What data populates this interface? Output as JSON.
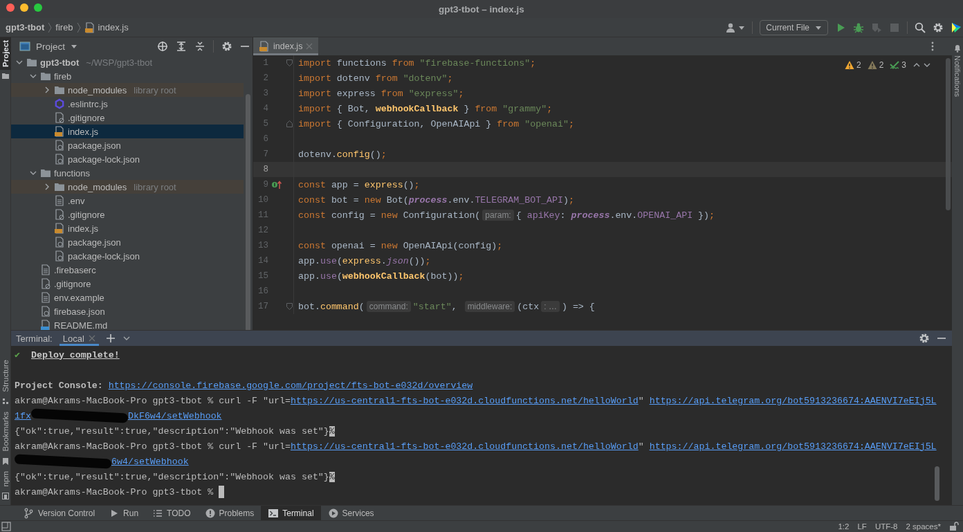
{
  "window": {
    "title": "gpt3-tbot – index.js"
  },
  "breadcrumbs": [
    {
      "label": "gpt3-tbot",
      "kind": "project"
    },
    {
      "label": "fireb",
      "kind": "folder"
    },
    {
      "label": "index.js",
      "kind": "js"
    }
  ],
  "toolbar": {
    "configuration": "Current File",
    "actions": [
      {
        "kind": "run",
        "disabled": false
      },
      {
        "kind": "debug",
        "disabled": false
      },
      {
        "kind": "coverage",
        "disabled": true
      },
      {
        "kind": "stop",
        "disabled": true
      }
    ]
  },
  "left_stripe": {
    "top": [
      {
        "label": "Project",
        "selected": true
      }
    ],
    "bottom": [
      {
        "label": "Structure",
        "selected": false
      },
      {
        "label": "Bookmarks",
        "selected": false
      },
      {
        "label": "npm",
        "selected": false
      }
    ]
  },
  "right_stripe": {
    "label": "Notifications"
  },
  "project_panel": {
    "title": "Project",
    "tree": [
      {
        "label": "gpt3-tbot",
        "path": "~/WSP/gpt3-tbot",
        "kind": "folder",
        "expanded": true,
        "selected": false,
        "children": [
          {
            "label": "fireb",
            "kind": "folder",
            "expanded": true,
            "selected": false,
            "children": [
              {
                "label": "node_modules",
                "note": "library root",
                "kind": "folder",
                "expanded": false,
                "selected": false
              },
              {
                "label": ".eslintrc.js",
                "kind": "eslint",
                "selected": false
              },
              {
                "label": ".gitignore",
                "kind": "ignore",
                "selected": false
              },
              {
                "label": "index.js",
                "kind": "js",
                "selected": true
              },
              {
                "label": "package.json",
                "kind": "json",
                "selected": false
              },
              {
                "label": "package-lock.json",
                "kind": "json",
                "selected": false
              }
            ]
          },
          {
            "label": "functions",
            "kind": "folder",
            "expanded": true,
            "selected": false,
            "children": [
              {
                "label": "node_modules",
                "note": "library root",
                "kind": "folder",
                "expanded": false,
                "selected": false
              },
              {
                "label": ".env",
                "kind": "text",
                "selected": false
              },
              {
                "label": ".gitignore",
                "kind": "ignore",
                "selected": false
              },
              {
                "label": "index.js",
                "kind": "js",
                "selected": false
              },
              {
                "label": "package.json",
                "kind": "json",
                "selected": false
              },
              {
                "label": "package-lock.json",
                "kind": "json",
                "selected": false
              }
            ]
          },
          {
            "label": ".firebaserc",
            "kind": "text",
            "selected": false
          },
          {
            "label": ".gitignore",
            "kind": "ignore",
            "selected": false
          },
          {
            "label": "env.example",
            "kind": "text",
            "selected": false
          },
          {
            "label": "firebase.json",
            "kind": "json",
            "selected": false
          },
          {
            "label": "README.md",
            "kind": "md",
            "selected": false
          }
        ]
      }
    ]
  },
  "editor": {
    "tabs": [
      {
        "label": "index.js",
        "selected": true
      }
    ],
    "inspections": [
      {
        "kind": "warning",
        "count": "2"
      },
      {
        "kind": "weak",
        "count": "2"
      },
      {
        "kind": "typo",
        "count": "3"
      }
    ],
    "lines": [
      {
        "number": "1",
        "kind": "foldstart",
        "current": false,
        "tokens": [
          {
            "kind": "kw",
            "text": "import"
          },
          {
            "kind": "plain",
            "text": " functions "
          },
          {
            "kind": "kw",
            "text": "from "
          },
          {
            "kind": "str",
            "text": "\"firebase-functions\""
          },
          {
            "kind": "kw",
            "text": ";"
          }
        ]
      },
      {
        "number": "2",
        "kind": "plain",
        "current": false,
        "tokens": [
          {
            "kind": "kw",
            "text": "import"
          },
          {
            "kind": "plain",
            "text": " dotenv "
          },
          {
            "kind": "kw",
            "text": "from "
          },
          {
            "kind": "str",
            "text": "\"dotenv\""
          },
          {
            "kind": "kw",
            "text": ";"
          }
        ]
      },
      {
        "number": "3",
        "kind": "plain",
        "current": false,
        "tokens": [
          {
            "kind": "kw",
            "text": "import"
          },
          {
            "kind": "plain",
            "text": " express "
          },
          {
            "kind": "kw",
            "text": "from "
          },
          {
            "kind": "str",
            "text": "\"express\""
          },
          {
            "kind": "kw",
            "text": ";"
          }
        ]
      },
      {
        "number": "4",
        "kind": "plain",
        "current": false,
        "tokens": [
          {
            "kind": "kw",
            "text": "import"
          },
          {
            "kind": "plain",
            "text": " { Bot, "
          },
          {
            "kind": "fnb",
            "text": "webhookCallback"
          },
          {
            "kind": "plain",
            "text": " } "
          },
          {
            "kind": "kw",
            "text": "from "
          },
          {
            "kind": "str",
            "text": "\"grammy\""
          },
          {
            "kind": "kw",
            "text": ";"
          }
        ]
      },
      {
        "number": "5",
        "kind": "foldend",
        "current": false,
        "tokens": [
          {
            "kind": "kw",
            "text": "import"
          },
          {
            "kind": "plain",
            "text": " { Configuration, OpenAIApi } "
          },
          {
            "kind": "kw",
            "text": "from "
          },
          {
            "kind": "str",
            "text": "\"openai\""
          },
          {
            "kind": "kw",
            "text": ";"
          }
        ]
      },
      {
        "number": "6",
        "kind": "plain",
        "current": false
      },
      {
        "number": "7",
        "kind": "plain",
        "current": false,
        "tokens": [
          {
            "kind": "plain",
            "text": "dotenv."
          },
          {
            "kind": "fn",
            "text": "config"
          },
          {
            "kind": "plain",
            "text": "()"
          },
          {
            "kind": "kw",
            "text": ";"
          }
        ]
      },
      {
        "number": "8",
        "kind": "plain",
        "current": true
      },
      {
        "number": "9",
        "kind": "override",
        "current": false,
        "tokens": [
          {
            "kind": "kw",
            "text": "const"
          },
          {
            "kind": "plain",
            "text": " app = "
          },
          {
            "kind": "fn",
            "text": "express"
          },
          {
            "kind": "plain",
            "text": "()"
          },
          {
            "kind": "kw",
            "text": ";"
          }
        ]
      },
      {
        "number": "10",
        "kind": "plain",
        "current": false,
        "tokens": [
          {
            "kind": "kw",
            "text": "const"
          },
          {
            "kind": "plain",
            "text": " bot = "
          },
          {
            "kind": "kw",
            "text": "new"
          },
          {
            "kind": "plain",
            "text": " Bot("
          },
          {
            "kind": "global",
            "text": "process"
          },
          {
            "kind": "plain",
            "text": ".env."
          },
          {
            "kind": "prop",
            "text": "TELEGRAM_BOT_API"
          },
          {
            "kind": "plain",
            "text": ")"
          },
          {
            "kind": "kw",
            "text": ";"
          }
        ]
      },
      {
        "number": "11",
        "kind": "plain",
        "current": false,
        "tokens": [
          {
            "kind": "kw",
            "text": "const"
          },
          {
            "kind": "plain",
            "text": " config = "
          },
          {
            "kind": "kw",
            "text": "new"
          },
          {
            "kind": "plain",
            "text": " Configuration("
          },
          {
            "kind": "hint",
            "text": "param:"
          },
          {
            "kind": "plain",
            "text": "{ "
          },
          {
            "kind": "prop",
            "text": "apiKey"
          },
          {
            "kind": "plain",
            "text": ": "
          },
          {
            "kind": "global",
            "text": "process"
          },
          {
            "kind": "plain",
            "text": ".env."
          },
          {
            "kind": "prop",
            "text": "OPENAI_API"
          },
          {
            "kind": "plain",
            "text": " })"
          },
          {
            "kind": "kw",
            "text": ";"
          }
        ]
      },
      {
        "number": "12",
        "kind": "plain",
        "current": false
      },
      {
        "number": "13",
        "kind": "plain",
        "current": false,
        "tokens": [
          {
            "kind": "kw",
            "text": "const"
          },
          {
            "kind": "plain",
            "text": " openai = "
          },
          {
            "kind": "kw",
            "text": "new"
          },
          {
            "kind": "plain",
            "text": " OpenAIApi(config)"
          },
          {
            "kind": "kw",
            "text": ";"
          }
        ]
      },
      {
        "number": "14",
        "kind": "plain",
        "current": false,
        "tokens": [
          {
            "kind": "plain",
            "text": "app."
          },
          {
            "kind": "prop",
            "text": "use"
          },
          {
            "kind": "plain",
            "text": "("
          },
          {
            "kind": "fn",
            "text": "express"
          },
          {
            "kind": "plain",
            "text": "."
          },
          {
            "kind": "method",
            "text": "json"
          },
          {
            "kind": "plain",
            "text": "())"
          },
          {
            "kind": "kw",
            "text": ";"
          }
        ]
      },
      {
        "number": "15",
        "kind": "plain",
        "current": false,
        "tokens": [
          {
            "kind": "plain",
            "text": "app."
          },
          {
            "kind": "prop",
            "text": "use"
          },
          {
            "kind": "plain",
            "text": "("
          },
          {
            "kind": "fnb",
            "text": "webhookCallback"
          },
          {
            "kind": "plain",
            "text": "(bot))"
          },
          {
            "kind": "kw",
            "text": ";"
          }
        ]
      },
      {
        "number": "16",
        "kind": "plain",
        "current": false
      },
      {
        "number": "17",
        "kind": "foldstart",
        "current": false,
        "tokens": [
          {
            "kind": "plain",
            "text": "bot."
          },
          {
            "kind": "fn",
            "text": "command"
          },
          {
            "kind": "plain",
            "text": "("
          },
          {
            "kind": "hint",
            "text": "command:"
          },
          {
            "kind": "str",
            "text": "\"start\""
          },
          {
            "kind": "plain",
            "text": ", "
          },
          {
            "kind": "hint",
            "text": "middleware:"
          },
          {
            "kind": "plain",
            "text": "(ctx"
          },
          {
            "kind": "hint",
            "text": ": …"
          },
          {
            "kind": "plain",
            "text": ") => {"
          }
        ]
      }
    ]
  },
  "terminal": {
    "label": "Terminal:",
    "tabs": [
      {
        "label": "Local",
        "selected": true
      }
    ],
    "lines": [
      {
        "segments": [
          {
            "kind": "check",
            "text": "✔"
          },
          {
            "kind": "heading",
            "text": "Deploy complete!"
          }
        ]
      },
      {
        "gap_before": true,
        "segments": [
          {
            "kind": "bold",
            "text": "Project Console: "
          },
          {
            "kind": "link",
            "text": "https://console.firebase.google.com/project/fts-bot-e032d/overview"
          }
        ]
      },
      {
        "segments": [
          {
            "kind": "text",
            "text": "akram@Akrams-MacBook-Pro gpt3-tbot % curl -F \"url="
          },
          {
            "kind": "link",
            "text": "https://us-central1-fts-bot-e032d.cloudfunctions.net/helloWorld"
          },
          {
            "kind": "text",
            "text": "\" "
          },
          {
            "kind": "link",
            "text": "https://api.telegram.org/bot5913236674:AAENVI7eEIj5L"
          }
        ]
      },
      {
        "segments": [
          {
            "kind": "link",
            "text": "1fx"
          },
          {
            "kind": "redacted"
          },
          {
            "kind": "link",
            "text": "DkF6w4/setWebhook"
          }
        ]
      },
      {
        "segments": [
          {
            "kind": "text",
            "text": "{\"ok\":true,\"result\":true,\"description\":\"Webhook was set\"}"
          },
          {
            "kind": "inverse",
            "text": "%"
          }
        ]
      },
      {
        "segments": [
          {
            "kind": "text",
            "text": "akram@Akrams-MacBook-Pro gpt3-tbot % curl -F \"url="
          },
          {
            "kind": "link",
            "text": "https://us-central1-fts-bot-e032d.cloudfunctions.net/helloWorld"
          },
          {
            "kind": "text",
            "text": "\" "
          },
          {
            "kind": "link",
            "text": "https://api.telegram.org/bot5913236674:AAENVI7eEIj5L"
          }
        ]
      },
      {
        "segments": [
          {
            "kind": "redacted"
          },
          {
            "kind": "link",
            "text": "6w4/setWebhook"
          }
        ]
      },
      {
        "segments": [
          {
            "kind": "text",
            "text": "{\"ok\":true,\"result\":true,\"description\":\"Webhook was set\"}"
          },
          {
            "kind": "inverse",
            "text": "%"
          }
        ]
      },
      {
        "segments": [
          {
            "kind": "text",
            "text": "akram@Akrams-MacBook-Pro gpt3-tbot % "
          },
          {
            "kind": "cursor"
          }
        ]
      }
    ]
  },
  "tool_tabs": [
    {
      "label": "Version Control",
      "kind": "vcs",
      "selected": false
    },
    {
      "label": "Run",
      "kind": "run",
      "selected": false
    },
    {
      "label": "TODO",
      "kind": "todo",
      "selected": false
    },
    {
      "label": "Problems",
      "kind": "problems",
      "selected": false
    },
    {
      "label": "Terminal",
      "kind": "terminal",
      "selected": true
    },
    {
      "label": "Services",
      "kind": "services",
      "selected": false
    }
  ],
  "status_bar": {
    "items": [
      "1:2",
      "LF",
      "UTF-8",
      "2 spaces*"
    ]
  }
}
